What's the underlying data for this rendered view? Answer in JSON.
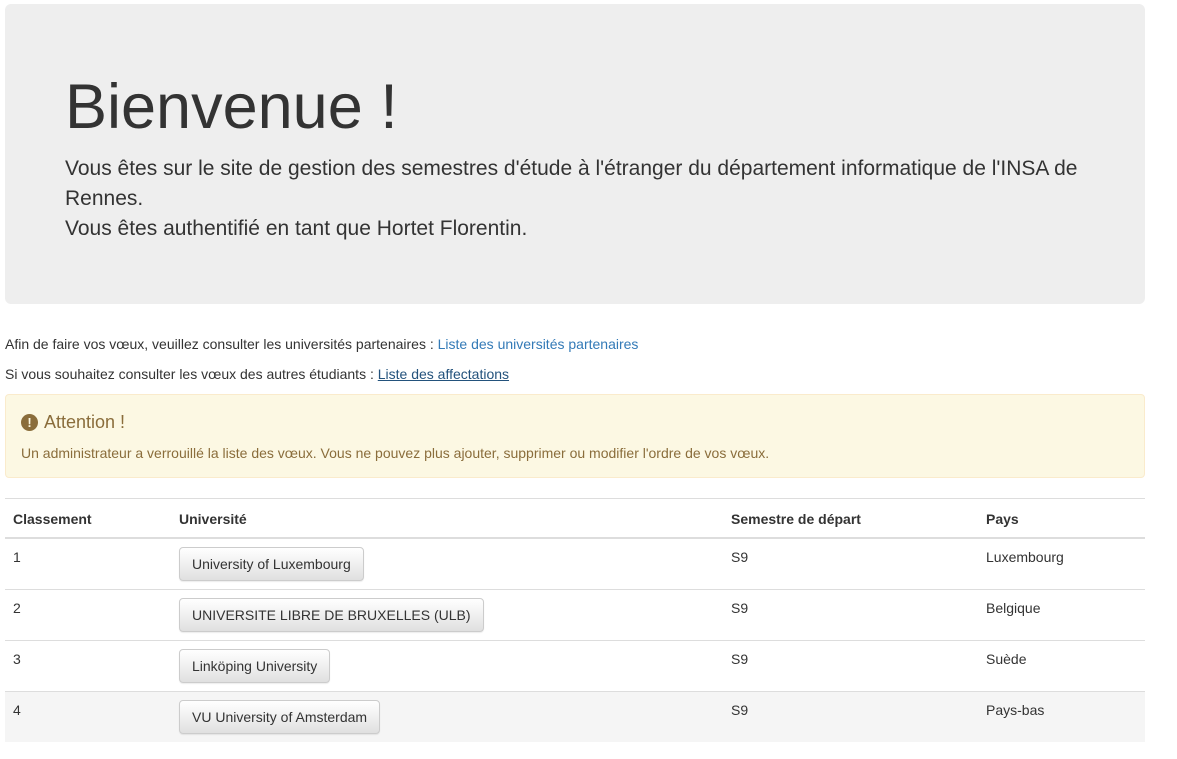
{
  "jumbotron": {
    "title": "Bienvenue !",
    "line1": "Vous êtes sur le site de gestion des semestres d'étude à l'étranger du département informatique de l'INSA de Rennes.",
    "line2": "Vous êtes authentifié en tant que Hortet Florentin."
  },
  "info": {
    "partners_text": "Afin de faire vos vœux, veuillez consulter les universités partenaires : ",
    "partners_link": "Liste des universités partenaires",
    "affect_text": "Si vous souhaitez consulter les vœux des autres étudiants : ",
    "affect_link": "Liste des affectations"
  },
  "alert": {
    "icon": "exclamation-circle-icon",
    "title": "Attention !",
    "text": "Un administrateur a verrouillé la liste des vœux. Vous ne pouvez plus ajouter, supprimer ou modifier l'ordre de vos vœux."
  },
  "table": {
    "headers": [
      "Classement",
      "Université",
      "Semestre de départ",
      "Pays"
    ],
    "rows": [
      {
        "rank": "1",
        "university": "University of Luxembourg",
        "semester": "S9",
        "country": "Luxembourg"
      },
      {
        "rank": "2",
        "university": "UNIVERSITE LIBRE DE BRUXELLES (ULB)",
        "semester": "S9",
        "country": "Belgique"
      },
      {
        "rank": "3",
        "university": "Linköping University",
        "semester": "S9",
        "country": "Suède"
      },
      {
        "rank": "4",
        "university": "VU University of Amsterdam",
        "semester": "S9",
        "country": "Pays-bas"
      }
    ]
  },
  "colors": {
    "jumbotron_bg": "#eeeeee",
    "link": "#337ab7",
    "alert_bg": "#fcf8e3",
    "alert_text": "#8a6d3b"
  }
}
